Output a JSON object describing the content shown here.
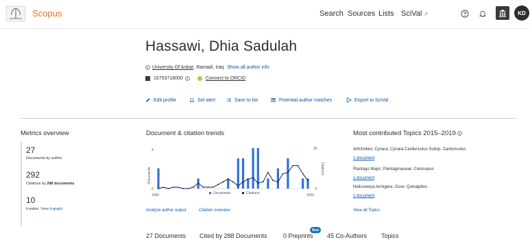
{
  "header": {
    "logo_text": "Scopus",
    "nav": [
      "Search",
      "Sources",
      "Lists",
      "SciVal"
    ],
    "avatar_initials": "KD",
    "brand_color": "#e9711c"
  },
  "author": {
    "name": "Hassawi, Dhia Sadulah",
    "affiliation": "University Of Anbar",
    "location": ", Ramadi, Iraq",
    "show_all_label": "Show all author info",
    "author_id": "15753718000",
    "orcid_label": "Connect to ORCID"
  },
  "actions": {
    "edit_profile": "Edit profile",
    "set_alert": "Set alert",
    "save_to_list": "Save to list",
    "potential_matches": "Potential author matches",
    "export_scival": "Export to SciVal"
  },
  "metrics": {
    "title": "Metrics overview",
    "documents_value": "27",
    "documents_label": "Documents by author",
    "citations_value": "292",
    "citations_label_prefix": "Citations by ",
    "citations_label_count": "288 documents",
    "hindex_value": "10",
    "hindex_label": "h-index:",
    "hindex_link": "View h-graph"
  },
  "trends": {
    "title": "Document & citation trends",
    "analyze_link": "Analyze author output",
    "citation_overview_link": "Citation overview"
  },
  "chart_data": {
    "type": "bar",
    "x": [
      1990,
      1991,
      1992,
      1993,
      1994,
      1995,
      1996,
      1997,
      1998,
      1999,
      2000,
      2001,
      2002,
      2003,
      2004,
      2005,
      2006,
      2007,
      2008,
      2009,
      2010,
      2011,
      2012,
      2013,
      2014,
      2015,
      2016,
      2017,
      2018,
      2019,
      2020
    ],
    "xlabel_ticks": [
      "1990",
      "2020"
    ],
    "series": [
      {
        "name": "Documents",
        "kind": "bar",
        "axis": "left",
        "color": "#2f72d4",
        "values": [
          2,
          0,
          0,
          0,
          0,
          0,
          0,
          0,
          1,
          0,
          0,
          0,
          0,
          0,
          1,
          0,
          3,
          3,
          1,
          4,
          4,
          0,
          1,
          0,
          2,
          0,
          3,
          0,
          0,
          1,
          1
        ]
      },
      {
        "name": "Citations",
        "kind": "line",
        "axis": "right",
        "color": "#1b1f5e",
        "values": [
          0,
          1,
          0,
          1,
          1,
          0,
          0,
          1,
          4,
          1,
          1,
          1,
          3,
          5,
          7,
          5,
          2,
          5,
          7,
          8,
          4,
          5,
          12,
          6,
          5,
          11,
          12,
          17,
          17,
          11,
          6
        ]
      }
    ],
    "ylabel": "Documents",
    "y2label": "Citations",
    "y_ticks": [
      "4",
      "0"
    ],
    "y2_ticks": [
      "30",
      "0"
    ],
    "ylim": [
      0,
      4
    ],
    "y2lim": [
      0,
      30
    ],
    "legend": "bottom"
  },
  "topics": {
    "title": "Most contributed Topics 2015–2019",
    "items": [
      {
        "name": "Artichokes; Cynara; Cynara Cardunculus Subsp. Cardunculus",
        "docs": "1 document"
      },
      {
        "name": "Plantago Major; Plantaginaceae; Coronopus",
        "docs": "1 document"
      },
      {
        "name": "Helicoverpa Armigera; Cicer; Quinalphos",
        "docs": "1 document"
      }
    ],
    "view_all": "View all Topics"
  },
  "tabs": {
    "documents": "27 Documents",
    "cited_by": "Cited by 288 Documents",
    "preprints": "0 Preprints",
    "new_badge": "New",
    "coauthors": "45 Co-Authors",
    "topics": "Topics"
  }
}
